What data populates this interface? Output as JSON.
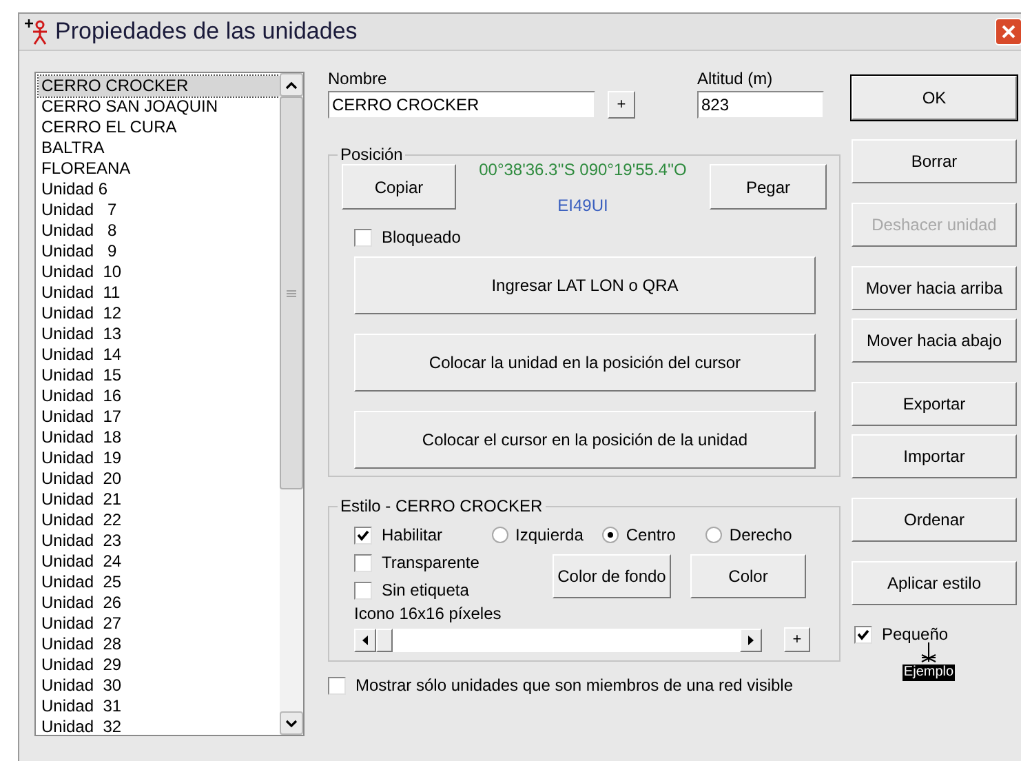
{
  "window": {
    "title": "Propiedades de las unidades"
  },
  "unit_list": {
    "items": [
      {
        "label": "CERRO CROCKER",
        "selected": true
      },
      {
        "label": "CERRO SAN JOAQUIN",
        "selected": false
      },
      {
        "label": "CERRO EL CURA",
        "selected": false
      },
      {
        "label": "BALTRA",
        "selected": false
      },
      {
        "label": "FLOREANA",
        "selected": false
      },
      {
        "label": "Unidad 6",
        "selected": false
      },
      {
        "label": "Unidad   7",
        "selected": false
      },
      {
        "label": "Unidad   8",
        "selected": false
      },
      {
        "label": "Unidad   9",
        "selected": false
      },
      {
        "label": "Unidad  10",
        "selected": false
      },
      {
        "label": "Unidad  11",
        "selected": false
      },
      {
        "label": "Unidad  12",
        "selected": false
      },
      {
        "label": "Unidad  13",
        "selected": false
      },
      {
        "label": "Unidad  14",
        "selected": false
      },
      {
        "label": "Unidad  15",
        "selected": false
      },
      {
        "label": "Unidad  16",
        "selected": false
      },
      {
        "label": "Unidad  17",
        "selected": false
      },
      {
        "label": "Unidad  18",
        "selected": false
      },
      {
        "label": "Unidad  19",
        "selected": false
      },
      {
        "label": "Unidad  20",
        "selected": false
      },
      {
        "label": "Unidad  21",
        "selected": false
      },
      {
        "label": "Unidad  22",
        "selected": false
      },
      {
        "label": "Unidad  23",
        "selected": false
      },
      {
        "label": "Unidad  24",
        "selected": false
      },
      {
        "label": "Unidad  25",
        "selected": false
      },
      {
        "label": "Unidad  26",
        "selected": false
      },
      {
        "label": "Unidad  27",
        "selected": false
      },
      {
        "label": "Unidad  28",
        "selected": false
      },
      {
        "label": "Unidad  29",
        "selected": false
      },
      {
        "label": "Unidad  30",
        "selected": false
      },
      {
        "label": "Unidad  31",
        "selected": false
      },
      {
        "label": "Unidad  32",
        "selected": false
      }
    ]
  },
  "name_field": {
    "label": "Nombre",
    "value": "CERRO CROCKER"
  },
  "name_add_button": "+",
  "altitude_field": {
    "label": "Altitud (m)",
    "value": "823"
  },
  "position": {
    "title": "Posición",
    "copy_button": "Copiar",
    "coordinates": "00°38'36.3''S 090°19'55.4''O",
    "locator": "EI49UI",
    "paste_button": "Pegar",
    "locked": {
      "label": "Bloqueado",
      "checked": false
    },
    "buttons": [
      "Ingresar LAT LON o QRA",
      "Colocar la unidad en la posición del cursor",
      "Colocar el cursor en la posición de la unidad"
    ]
  },
  "style": {
    "title": "Estilo - CERRO CROCKER",
    "options": [
      {
        "label": "Habilitar",
        "checked": true
      },
      {
        "label": "Transparente",
        "checked": false
      },
      {
        "label": "Sin etiqueta",
        "checked": false
      }
    ],
    "alignment": [
      {
        "label": "Izquierda",
        "selected": false
      },
      {
        "label": "Centro",
        "selected": true
      },
      {
        "label": "Derecho",
        "selected": false
      }
    ],
    "background_color_button": "Color de fondo",
    "color_button": "Color",
    "icon_size": {
      "label": "Icono 16x16 píxeles",
      "level": 0
    },
    "add_button": "+"
  },
  "visible_network_only": {
    "label": "Mostrar sólo unidades que son miembros de una red visible",
    "checked": false
  },
  "actions": [
    {
      "label": "OK",
      "disabled": false,
      "default": true
    },
    {
      "label": "Borrar",
      "disabled": false,
      "default": false
    },
    {
      "label": "Deshacer unidad",
      "disabled": true,
      "default": false
    },
    {
      "label": "Mover hacia arriba",
      "disabled": false,
      "default": false
    },
    {
      "label": "Mover hacia abajo",
      "disabled": false,
      "default": false
    },
    {
      "label": "Exportar",
      "disabled": false,
      "default": false
    },
    {
      "label": "Importar",
      "disabled": false,
      "default": false
    },
    {
      "label": "Ordenar",
      "disabled": false,
      "default": false
    },
    {
      "label": "Aplicar estilo",
      "disabled": false,
      "default": false
    }
  ],
  "small": {
    "label": "Pequeño",
    "checked": true
  },
  "example_label": "Ejemplo"
}
